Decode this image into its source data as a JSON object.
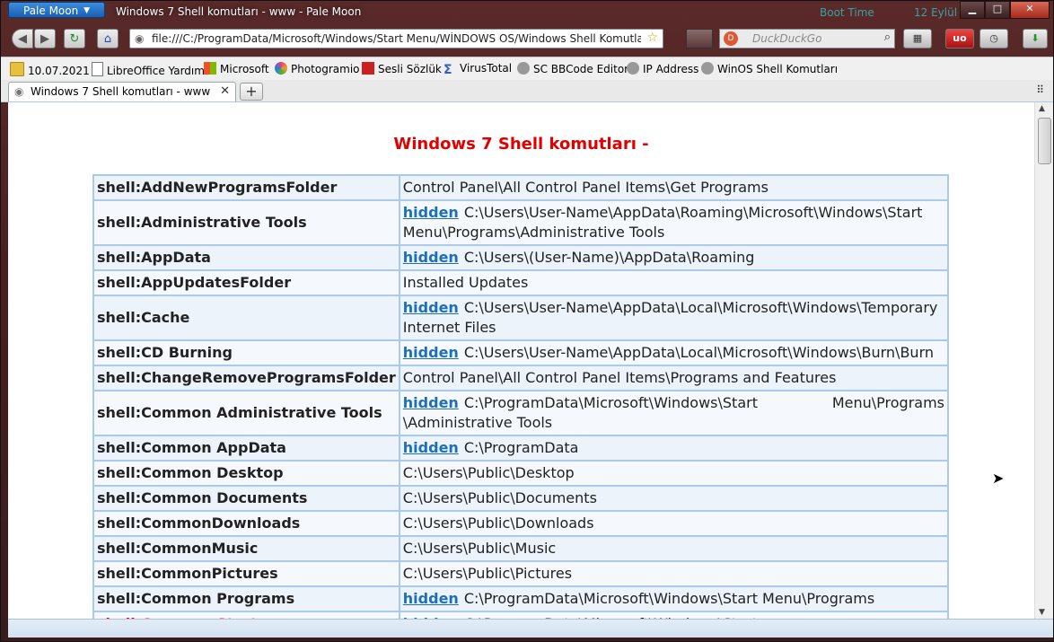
{
  "window": {
    "app_menu": "Pale Moon",
    "title": "Windows 7 Shell komutları - www - Pale Moon",
    "gadget_boot": "Boot Time",
    "gadget_date": "12 Eylül",
    "controls": {
      "minimize": "▁",
      "maximize": "□",
      "close": "✕"
    }
  },
  "nav": {
    "back": "◀",
    "forward": "▶",
    "reload": "↻",
    "home": "⌂",
    "url": "file:///C:/ProgramData/Microsoft/Windows/Start Menu/WİNDOWS OS/Windows Shell Komutları.htm",
    "search_placeholder": "DuckDuckGo",
    "search_engine_icon": "D",
    "extensions": [
      "▦",
      "uo",
      "◷",
      "⬇"
    ]
  },
  "bookmarks": [
    {
      "label": "10.07.2021",
      "icon": "folder-icon",
      "color": "#e8c040"
    },
    {
      "label": "LibreOffice Yardım",
      "icon": "page-icon",
      "color": "#ffffff"
    },
    {
      "label": "Microsoft",
      "icon": "microsoft-icon",
      "color": "#f25022"
    },
    {
      "label": "Photogramio",
      "icon": "photogramio-icon",
      "color": "#e04080"
    },
    {
      "label": "Sesli Sözlük",
      "icon": "sozluk-icon",
      "color": "#cc2020"
    },
    {
      "label": "VirusTotal",
      "icon": "virustotal-icon",
      "color": "#3060c0"
    },
    {
      "label": "SC BBCode Editor",
      "icon": "globe-icon",
      "color": "#888888"
    },
    {
      "label": "IP Address",
      "icon": "globe-icon",
      "color": "#888888"
    },
    {
      "label": "WinOS Shell Komutları",
      "icon": "globe-icon",
      "color": "#888888"
    }
  ],
  "tab": {
    "title": "Windows 7 Shell komutları - www",
    "close": "✕",
    "new_tab": "+",
    "tab_list": "⠿"
  },
  "page": {
    "title": "Windows 7 Shell komutları -",
    "rows": [
      {
        "key": "shell:AddNewProgramsFolder",
        "link": "",
        "value": "Control Panel\\All Control Panel Items\\Get Programs"
      },
      {
        "key": "shell:Administrative Tools",
        "link": "hidden",
        "value": "C:\\Users\\User-Name\\AppData\\Roaming\\Microsoft\\Windows\\Start Menu\\Programs\\Administrative Tools"
      },
      {
        "key": "shell:AppData",
        "link": "hidden",
        "value": "C:\\Users\\(User-Name)\\AppData\\Roaming"
      },
      {
        "key": "shell:AppUpdatesFolder",
        "link": "",
        "value": "Installed Updates"
      },
      {
        "key": "shell:Cache",
        "link": "hidden",
        "value": "C:\\Users\\User-Name\\AppData\\Local\\Microsoft\\Windows\\Temporary Internet Files"
      },
      {
        "key": "shell:CD Burning",
        "link": "hidden",
        "value": "C:\\Users\\User-Name\\AppData\\Local\\Microsoft\\Windows\\Burn\\Burn"
      },
      {
        "key": "shell:ChangeRemoveProgramsFolder",
        "link": "",
        "value": "Control Panel\\All Control Panel Items\\Programs and Features"
      },
      {
        "key": "shell:Common Administrative Tools",
        "link": "hidden",
        "value": "C:\\ProgramData\\Microsoft\\Windows\\Start Menu\\Programs \\Administrative Tools"
      },
      {
        "key": "shell:Common AppData",
        "link": "hidden",
        "value": "C:\\ProgramData"
      },
      {
        "key": "shell:Common Desktop",
        "link": "",
        "value": "C:\\Users\\Public\\Desktop"
      },
      {
        "key": "shell:Common Documents",
        "link": "",
        "value": "C:\\Users\\Public\\Documents"
      },
      {
        "key": "shell:CommonDownloads",
        "link": "",
        "value": "C:\\Users\\Public\\Downloads"
      },
      {
        "key": "shell:CommonMusic",
        "link": "",
        "value": "C:\\Users\\Public\\Music"
      },
      {
        "key": "shell:CommonPictures",
        "link": "",
        "value": "C:\\Users\\Public\\Pictures"
      },
      {
        "key": "shell:Common Programs",
        "link": "hidden",
        "value": "C:\\ProgramData\\Microsoft\\Windows\\Start Menu\\Programs"
      },
      {
        "key": "shell:Common Start",
        "link": "hidden",
        "value": "C:\\ProgramData\\Microsoft\\Windows\\Start",
        "partial": true
      }
    ]
  }
}
